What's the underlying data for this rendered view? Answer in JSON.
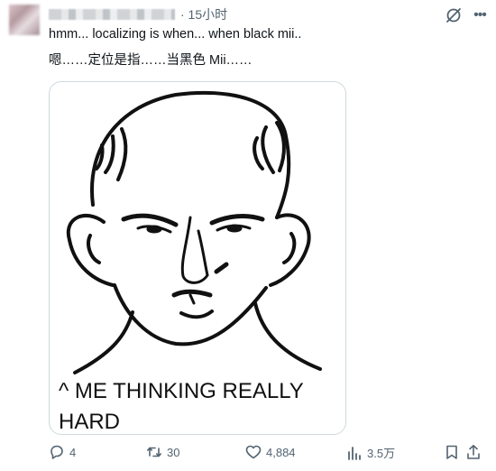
{
  "post": {
    "time": "· 15小时",
    "text_line1": "hmm... localizing is when... when black mii..",
    "text_line2": "嗯……定位是指……当黑色 Mii……",
    "image_caption_line1": "^ ME THINKING REALLY",
    "image_caption_line2": "HARD"
  },
  "actions": {
    "replies": "4",
    "reposts": "30",
    "likes": "4,884",
    "views": "3.5万"
  },
  "icons": {
    "grok": "grok-icon",
    "more": "more-icon",
    "reply": "reply-icon",
    "repost": "repost-icon",
    "like": "heart-icon",
    "views": "views-icon",
    "bookmark": "bookmark-icon",
    "share": "share-icon"
  }
}
